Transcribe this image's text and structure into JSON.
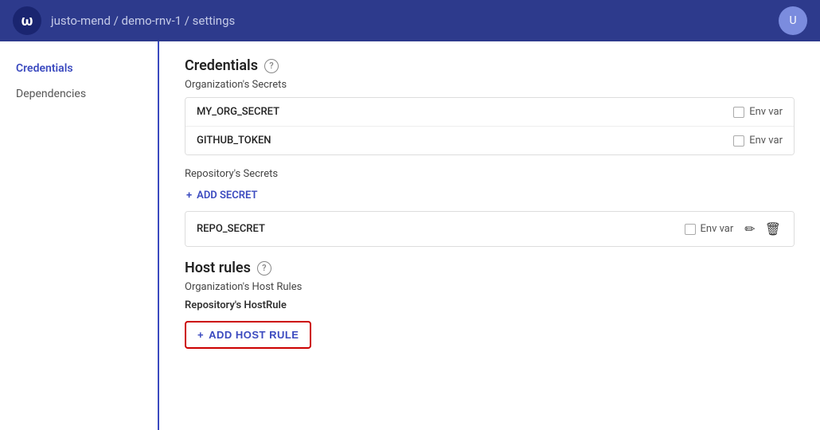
{
  "header": {
    "breadcrumb": "justo-mend / demo-rnv-1 / settings",
    "logo_symbol": "ω",
    "avatar_initials": "U"
  },
  "sidebar": {
    "items": [
      {
        "id": "credentials",
        "label": "Credentials",
        "active": true
      },
      {
        "id": "dependencies",
        "label": "Dependencies",
        "active": false
      }
    ]
  },
  "credentials": {
    "section_title": "Credentials",
    "org_secrets_label": "Organization's Secrets",
    "org_secrets": [
      {
        "name": "MY_ORG_SECRET",
        "env_var_label": "Env var"
      },
      {
        "name": "GITHUB_TOKEN",
        "env_var_label": "Env var"
      }
    ],
    "repo_secrets_label": "Repository's Secrets",
    "add_secret_label": "ADD SECRET",
    "repo_secrets": [
      {
        "name": "REPO_SECRET",
        "env_var_label": "Env var"
      }
    ]
  },
  "host_rules": {
    "section_title": "Host rules",
    "org_host_rules_label": "Organization's Host Rules",
    "repo_host_rule_label": "Repository's HostRule",
    "add_host_rule_label": "ADD HOST RULE"
  },
  "icons": {
    "plus": "+",
    "edit": "✏",
    "delete": "🗑",
    "help": "?"
  }
}
